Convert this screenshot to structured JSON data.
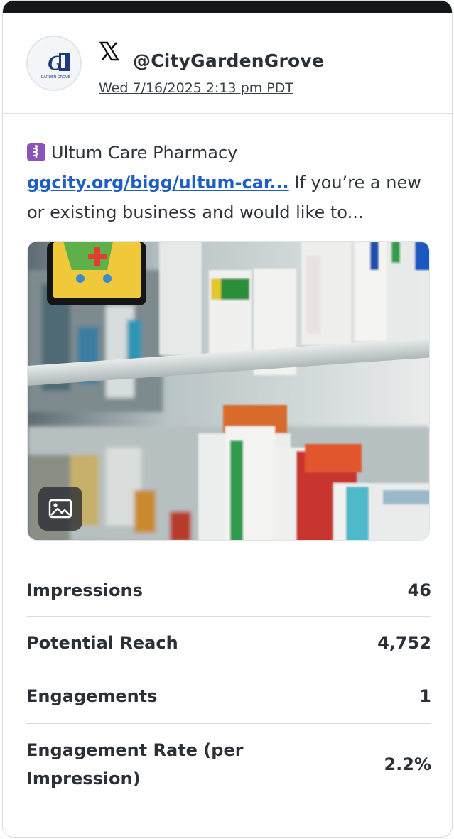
{
  "post": {
    "network_icon": "x-logo-icon",
    "handle": "@CityGardenGrove",
    "timestamp": "Wed 7/16/2025 2:13 pm PDT",
    "avatar_text": "GARDEN GROVE",
    "emoji_icon": "medical-symbol-icon",
    "title": "Ultum Care Pharmacy",
    "link_text": "ggcity.org/bigg/ultum-car...",
    "text_after_link": " If you’re a new or existing business and would like to...",
    "image_icon": "image-icon",
    "image_alt": "pharmacy-shelves-photo"
  },
  "stats": [
    {
      "label": "Impressions",
      "value": "46"
    },
    {
      "label": "Potential Reach",
      "value": "4,752"
    },
    {
      "label": "Engagements",
      "value": "1"
    },
    {
      "label": "Engagement Rate (per Impression)",
      "value": "2.2%"
    }
  ],
  "colors": {
    "link": "#1f5fbf",
    "topbar": "#14171a",
    "text": "#2b3037"
  }
}
